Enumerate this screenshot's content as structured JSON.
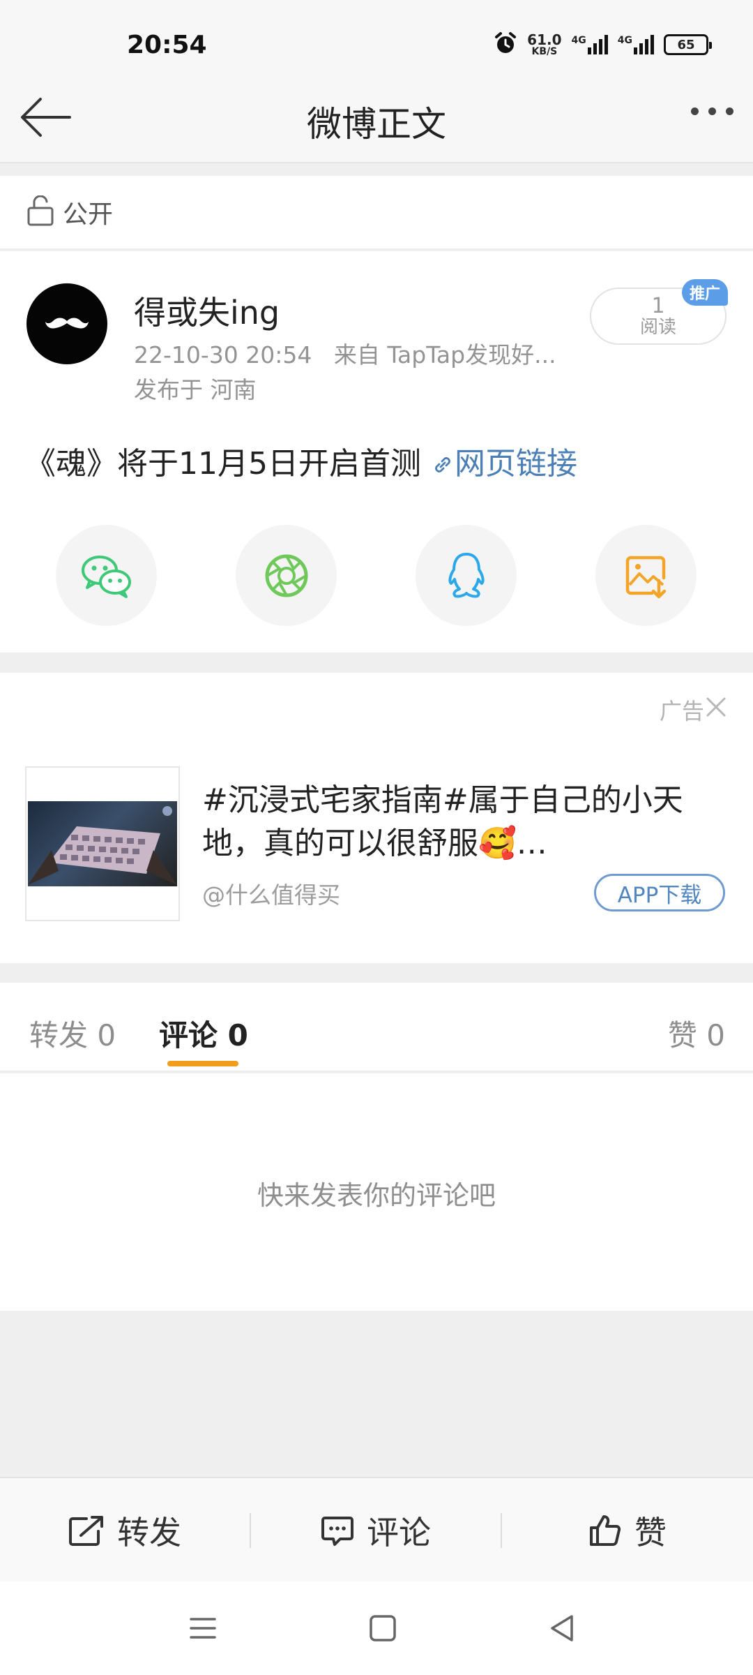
{
  "status_bar": {
    "time": "20:54",
    "speed_value": "61.0",
    "speed_unit": "KB/S",
    "network1": "4G",
    "network2": "4G",
    "battery": "65"
  },
  "nav": {
    "title": "微博正文",
    "back_icon": "arrow-left-icon",
    "more_icon": "more-dots-icon"
  },
  "privacy": {
    "label": "公开",
    "icon": "unlock-icon"
  },
  "post": {
    "username": "得或失ing",
    "time": "22-10-30 20:54",
    "source": "来自 TapTap发现好...",
    "location": "发布于 河南",
    "read_count": "1",
    "read_label": "阅读",
    "promo_badge": "推广",
    "text": "《魂》将于11月5日开启首测",
    "link_text": "网页链接",
    "link_icon": "link-icon"
  },
  "share": [
    {
      "icon": "wechat-icon",
      "color": "#3ec877"
    },
    {
      "icon": "moments-icon",
      "color": "#6fc85a"
    },
    {
      "icon": "qq-icon",
      "color": "#2ca8e8"
    },
    {
      "icon": "save-image-icon",
      "color": "#f3a52a"
    }
  ],
  "ad": {
    "label": "广告",
    "title": "#沉浸式宅家指南#属于自己的小天地，真的可以很舒服🥰…",
    "source": "@什么值得买",
    "button": "APP下载"
  },
  "tabs": [
    {
      "label": "转发 0",
      "active": false
    },
    {
      "label": "评论 0",
      "active": true
    },
    {
      "label": "赞 0",
      "active": false
    }
  ],
  "empty_comments": "快来发表你的评论吧",
  "actions": {
    "repost": "转发",
    "comment": "评论",
    "like": "赞"
  },
  "accent_color": "#f19d1b",
  "link_color": "#4b7fb5"
}
